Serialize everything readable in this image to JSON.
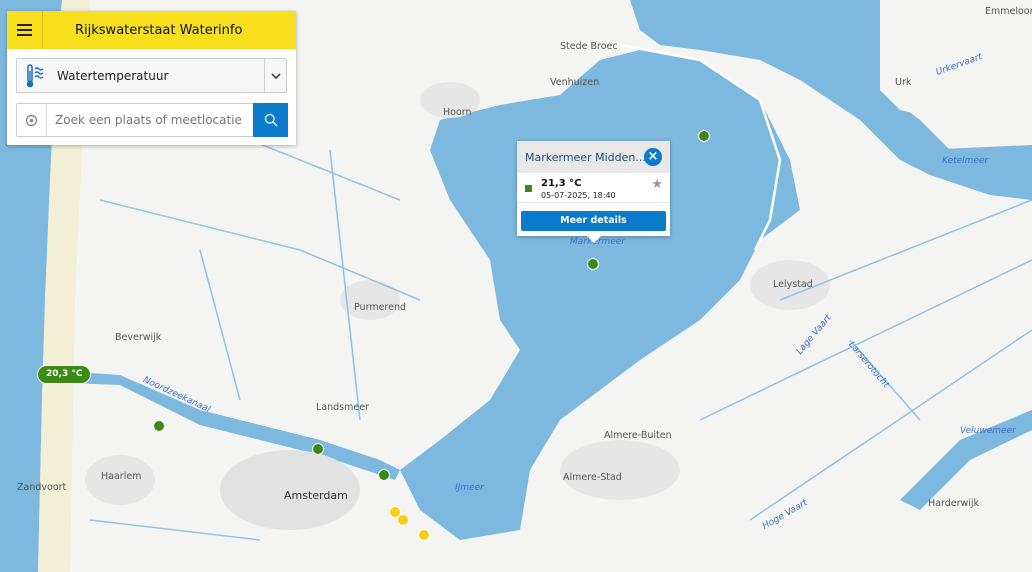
{
  "header": {
    "title": "Rijkswaterstaat Waterinfo",
    "menu_icon": "hamburger-icon"
  },
  "parameter_select": {
    "value": "Watertemperatuur",
    "icon": "water-temperature-icon"
  },
  "search": {
    "placeholder": "Zoek een plaats of meetlocatie"
  },
  "popup": {
    "title": "Markermeer Midden...",
    "value": "21,3 °C",
    "datetime": "05-07-2025, 18:40",
    "details_button": "Meer details",
    "status_color": "#3a8a14"
  },
  "badge": {
    "value": "20,3 °C"
  },
  "map": {
    "places": [
      "Stede Broec",
      "Venhuizen",
      "Hoorn",
      "Urk",
      "Emmeloord",
      "Lelystad",
      "Purmerend",
      "Beverwijk",
      "Landsmeer",
      "Amsterdam",
      "Haarlem",
      "Zandvoort",
      "Almere-Buiten",
      "Almere-Stad",
      "Harderwijk"
    ],
    "water_labels": [
      "Markermeer",
      "Ketelmeer",
      "IJmeer",
      "Veluwemeer",
      "Urkervaart",
      "Lage Vaart",
      "Hoge Vaart",
      "Larserotocht",
      "Noordzeekanaal"
    ]
  }
}
